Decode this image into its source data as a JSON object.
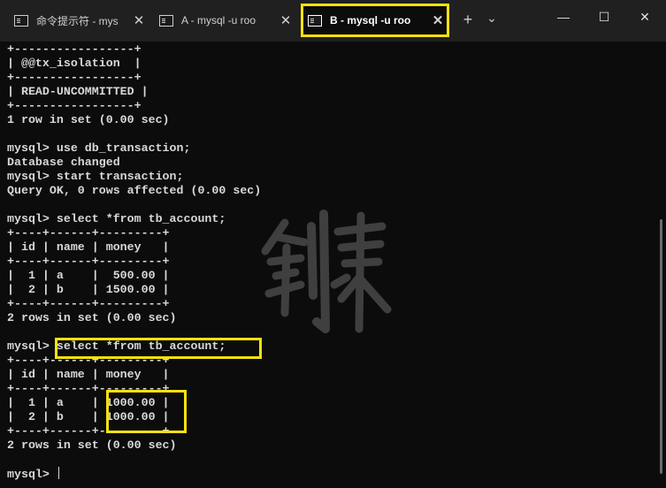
{
  "tabs": [
    {
      "label": "命令提示符 - mys",
      "icon": "terminal-icon"
    },
    {
      "label": "A - mysql  -u roo",
      "icon": "terminal-icon"
    },
    {
      "label": "B - mysql  -u roo",
      "icon": "terminal-icon"
    }
  ],
  "toolbar": {
    "new_tab": "+",
    "dropdown": "⌄"
  },
  "window": {
    "minimize": "—",
    "maximize": "☐",
    "close": "✕"
  },
  "terminal": {
    "lines": [
      "+-----------------+",
      "| @@tx_isolation  |",
      "+-----------------+",
      "| READ-UNCOMMITTED |",
      "+-----------------+",
      "1 row in set (0.00 sec)",
      "",
      "mysql> use db_transaction;",
      "Database changed",
      "mysql> start transaction;",
      "Query OK, 0 rows affected (0.00 sec)",
      "",
      "mysql> select *from tb_account;",
      "+----+------+---------+",
      "| id | name | money   |",
      "+----+------+---------+",
      "|  1 | a    |  500.00 |",
      "|  2 | b    | 1500.00 |",
      "+----+------+---------+",
      "2 rows in set (0.00 sec)",
      "",
      "mysql> select *from tb_account;",
      "+----+------+---------+",
      "| id | name | money   |",
      "+----+------+---------+",
      "|  1 | a    | 1000.00 |",
      "|  2 | b    | 1000.00 |",
      "+----+------+---------+",
      "2 rows in set (0.00 sec)",
      "",
      "mysql> "
    ]
  },
  "watermark": "剑来",
  "colors": {
    "highlight": "#f5e20c",
    "background": "#0c0c0c",
    "tabbar": "#202020"
  }
}
